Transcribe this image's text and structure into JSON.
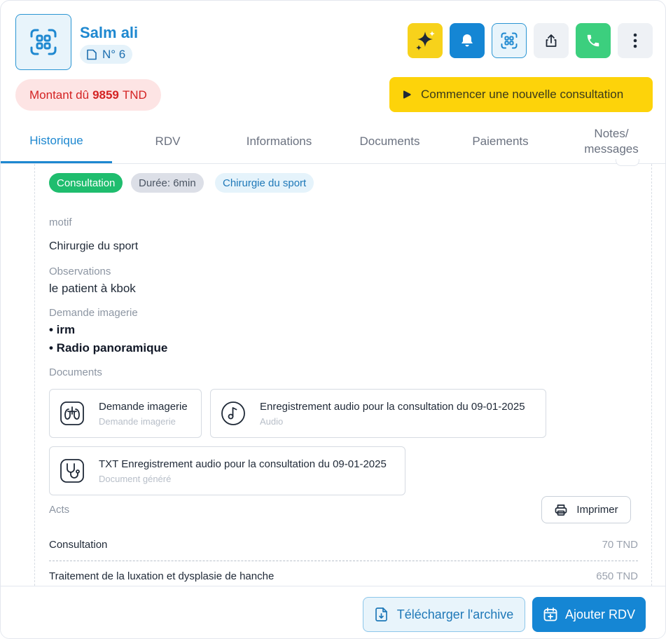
{
  "patient": {
    "name": "Salm ali",
    "number": "N° 6"
  },
  "balance": {
    "prefix": "Montant dû",
    "amount": "9859",
    "currency": "TND"
  },
  "actions": {
    "start_consultation": "Commencer une nouvelle consultation"
  },
  "header_icons": [
    "sparkles-icon",
    "bell-icon",
    "qr-scan-icon",
    "share-icon",
    "phone-icon",
    "more-vertical-icon"
  ],
  "tabs": [
    {
      "label": "Historique",
      "active": true
    },
    {
      "label": "RDV"
    },
    {
      "label": "Informations"
    },
    {
      "label": "Documents"
    },
    {
      "label": "Paiements"
    },
    {
      "label": "Notes/\nmessages"
    }
  ],
  "consultation": {
    "type_badge": "Consultation",
    "duration_badge": "Durée: 6min",
    "specialty_badge": "Chirurgie du sport",
    "motif_label": "motif",
    "motif_value": "Chirurgie du sport",
    "observations_label": "Observations",
    "observations_value": "le patient à kbok",
    "imaging_label": "Demande imagerie",
    "imaging_items": [
      "• irm",
      "• Radio panoramique"
    ],
    "documents_label": "Documents",
    "documents": [
      {
        "title": "Demande imagerie",
        "subtitle": "Demande imagerie",
        "icon": "lungs-icon"
      },
      {
        "title": "Enregistrement audio pour la consultation du 09-01-2025",
        "subtitle": "Audio",
        "icon": "music-note-icon"
      },
      {
        "title": "TXT Enregistrement audio pour la consultation du 09-01-2025",
        "subtitle": "Document généré",
        "icon": "stethoscope-icon"
      }
    ],
    "acts_label": "Acts",
    "print_label": "Imprimer",
    "acts": [
      {
        "name": "Consultation",
        "price": "70 TND"
      },
      {
        "name": "Traitement de la luxation et dysplasie de hanche",
        "price": "650 TND"
      }
    ]
  },
  "footer": {
    "download_label": "Télécharger l'archive",
    "add_rdv_label": "Ajouter RDV"
  },
  "colors": {
    "primary": "#1586d4",
    "accent_yellow": "#fdd30a",
    "success": "#1fbd6e",
    "danger": "#d42323"
  }
}
